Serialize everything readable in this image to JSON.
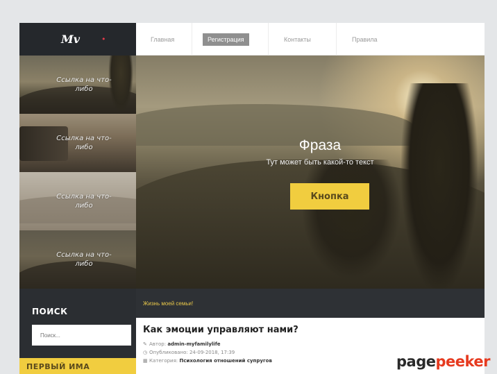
{
  "logo": {
    "text": "Mv",
    "dot": "•",
    "accent": "#e53a4b"
  },
  "nav": {
    "items": [
      {
        "label": "Главная"
      },
      {
        "label": "Регистрация",
        "active": true
      },
      {
        "label": "Контакты"
      },
      {
        "label": "Правила"
      }
    ]
  },
  "thumbnails": [
    {
      "label": "Ссылка на что-либо"
    },
    {
      "label": "Ссылка на что-либо"
    },
    {
      "label": "Ссылка на что-либо"
    },
    {
      "label": "Ссылка на что-либо"
    }
  ],
  "hero": {
    "title": "Фраза",
    "subtitle": "Тут может быть какой-то текст",
    "button": "Кнопка",
    "button_color": "#f1cd3f"
  },
  "sidebar": {
    "search_title": "ПОИСК",
    "search_placeholder": "Поиск...",
    "next_block_title": "ПЕРВЫЙ ИМА"
  },
  "content": {
    "breadcrumb": "Жизнь моей семьи!",
    "article": {
      "title": "Как эмоции управляют нами?",
      "author_label": "Автор:",
      "author": "admin-myfamilylife",
      "published_label": "Опубликовано:",
      "published": "24-09-2018, 17:39",
      "category_label": "Категория:",
      "category": "Психология отношений супругов"
    }
  },
  "watermark": {
    "part1": "page",
    "part2": "peeker"
  }
}
